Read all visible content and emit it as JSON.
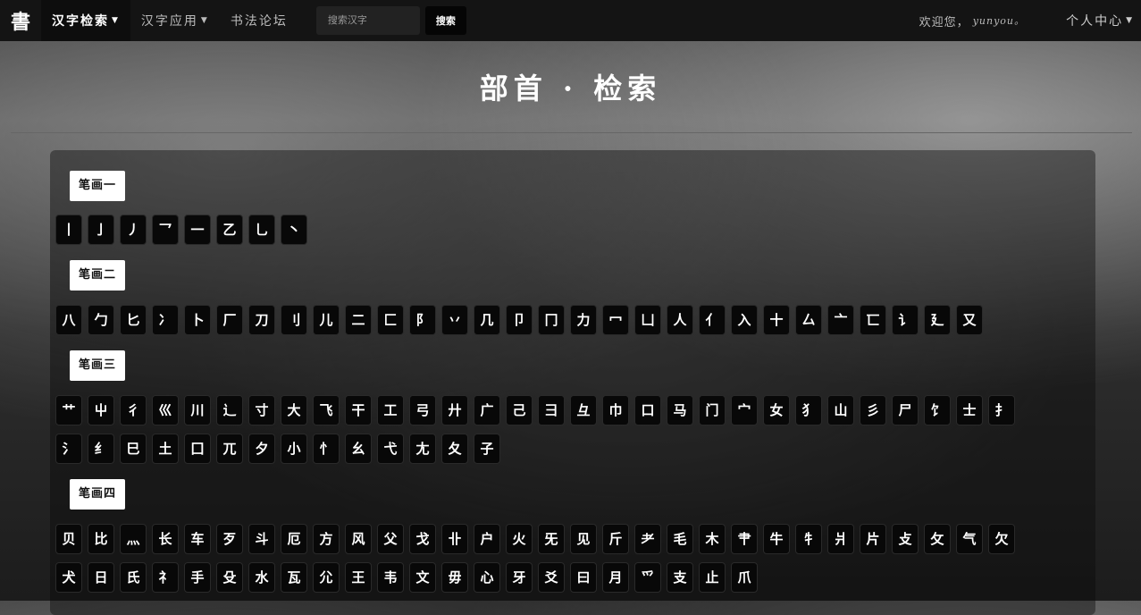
{
  "navbar": {
    "brand": "書",
    "menu": [
      {
        "label": "汉字检索",
        "active": true,
        "dropdown": true
      },
      {
        "label": "汉字应用",
        "active": false,
        "dropdown": true
      },
      {
        "label": "书法论坛",
        "active": false,
        "dropdown": false
      }
    ],
    "search_placeholder": "搜索汉字",
    "search_button": "搜索",
    "welcome_prefix": "欢迎您，",
    "username": "yunyou。",
    "user_center": "个人中心"
  },
  "page_title": "部首 · 检索",
  "groups": [
    {
      "label": "笔画一",
      "rows": [
        [
          "丨",
          "亅",
          "丿",
          "乛",
          "一",
          "乙",
          "乚",
          "丶"
        ]
      ]
    },
    {
      "label": "笔画二",
      "rows": [
        [
          "八",
          "勹",
          "匕",
          "冫",
          "卜",
          "厂",
          "刀",
          "刂",
          "儿",
          "二",
          "匚",
          "阝",
          "丷",
          "几",
          "卩",
          "冂",
          "力",
          "冖",
          "凵",
          "人",
          "亻",
          "入",
          "十",
          "厶",
          "亠",
          "匸",
          "讠",
          "廴",
          "又"
        ]
      ]
    },
    {
      "label": "笔画三",
      "rows": [
        [
          "艹",
          "屮",
          "彳",
          "巛",
          "川",
          "辶",
          "寸",
          "大",
          "飞",
          "干",
          "工",
          "弓",
          "廾",
          "广",
          "己",
          "彐",
          "彑",
          "巾",
          "口",
          "马",
          "门",
          "宀",
          "女",
          "犭",
          "山",
          "彡",
          "尸",
          "饣",
          "士",
          "扌"
        ],
        [
          "氵",
          "纟",
          "巳",
          "土",
          "囗",
          "兀",
          "夕",
          "小",
          "忄",
          "幺",
          "弋",
          "尢",
          "夂",
          "子"
        ]
      ]
    },
    {
      "label": "笔画四",
      "rows": [
        [
          "贝",
          "比",
          "灬",
          "长",
          "车",
          "歹",
          "斗",
          "厄",
          "方",
          "风",
          "父",
          "戈",
          "卝",
          "户",
          "火",
          "旡",
          "见",
          "斤",
          "耂",
          "毛",
          "木",
          "肀",
          "牛",
          "牜",
          "爿",
          "片",
          "攴",
          "攵",
          "气",
          "欠"
        ],
        [
          "犬",
          "日",
          "氏",
          "礻",
          "手",
          "殳",
          "水",
          "瓦",
          "尣",
          "王",
          "韦",
          "文",
          "毋",
          "心",
          "牙",
          "爻",
          "曰",
          "月",
          "爫",
          "支",
          "止",
          "爪"
        ]
      ]
    }
  ]
}
